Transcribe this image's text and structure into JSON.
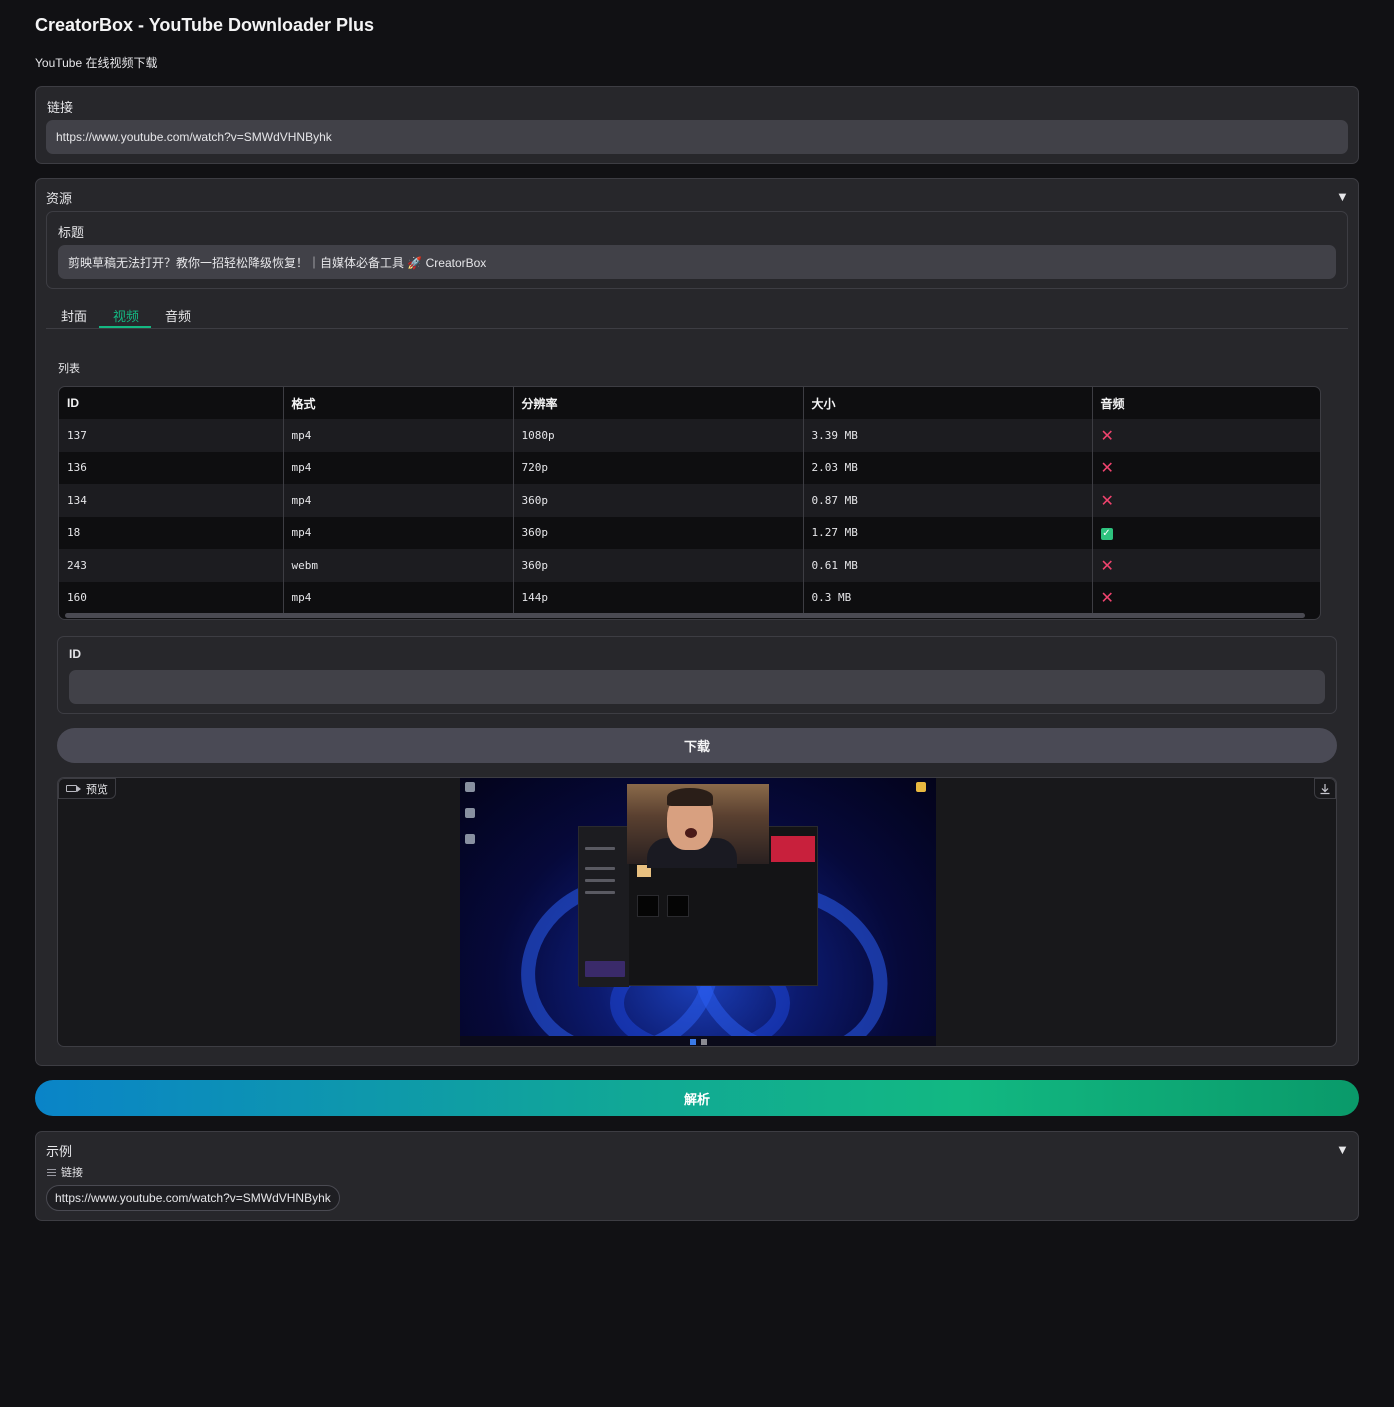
{
  "app": {
    "title": "CreatorBox - YouTube Downloader Plus",
    "subtitle": "YouTube 在线视频下载"
  },
  "link_section": {
    "label": "链接",
    "value": "https://www.youtube.com/watch?v=SMWdVHNByhk"
  },
  "resources": {
    "label": "资源",
    "caret": "▼",
    "title_label": "标题",
    "title_value": "剪映草稿无法打开？教你一招轻松降级恢复！｜自媒体必备工具 🚀 CreatorBox",
    "tabs": [
      {
        "label": "封面",
        "active": false
      },
      {
        "label": "视频",
        "active": true
      },
      {
        "label": "音频",
        "active": false
      }
    ],
    "list_label": "列表",
    "table": {
      "headers": [
        "ID",
        "格式",
        "分辨率",
        "大小",
        "音频"
      ],
      "rows": [
        {
          "id": "137",
          "format": "mp4",
          "resolution": "1080p",
          "size": "3.39 MB",
          "audio": false
        },
        {
          "id": "136",
          "format": "mp4",
          "resolution": "720p",
          "size": "2.03 MB",
          "audio": false
        },
        {
          "id": "134",
          "format": "mp4",
          "resolution": "360p",
          "size": "0.87 MB",
          "audio": false
        },
        {
          "id": "18",
          "format": "mp4",
          "resolution": "360p",
          "size": "1.27 MB",
          "audio": true
        },
        {
          "id": "243",
          "format": "webm",
          "resolution": "360p",
          "size": "0.61 MB",
          "audio": false
        },
        {
          "id": "160",
          "format": "mp4",
          "resolution": "144p",
          "size": "0.3 MB",
          "audio": false
        }
      ],
      "audio_no_glyph": "✕",
      "audio_yes_glyph": "✓"
    },
    "id_label": "ID",
    "id_value": "",
    "download_label": "下载",
    "preview_label": "预览"
  },
  "parse_button": {
    "label": "解析"
  },
  "examples": {
    "label": "示例",
    "caret": "▼",
    "column_label": "链接",
    "items": [
      "https://www.youtube.com/watch?v=SMWdVHNByhk"
    ]
  },
  "colors": {
    "accent": "#14b882",
    "background": "#111114",
    "panel": "#27272b",
    "error": "#f0436e",
    "success": "#2ec27e"
  },
  "icons": {
    "collapse": "chevron-down-icon",
    "preview": "video-icon",
    "download": "download-icon",
    "no_audio": "cross-icon",
    "has_audio": "check-icon",
    "example_list": "list-icon"
  }
}
